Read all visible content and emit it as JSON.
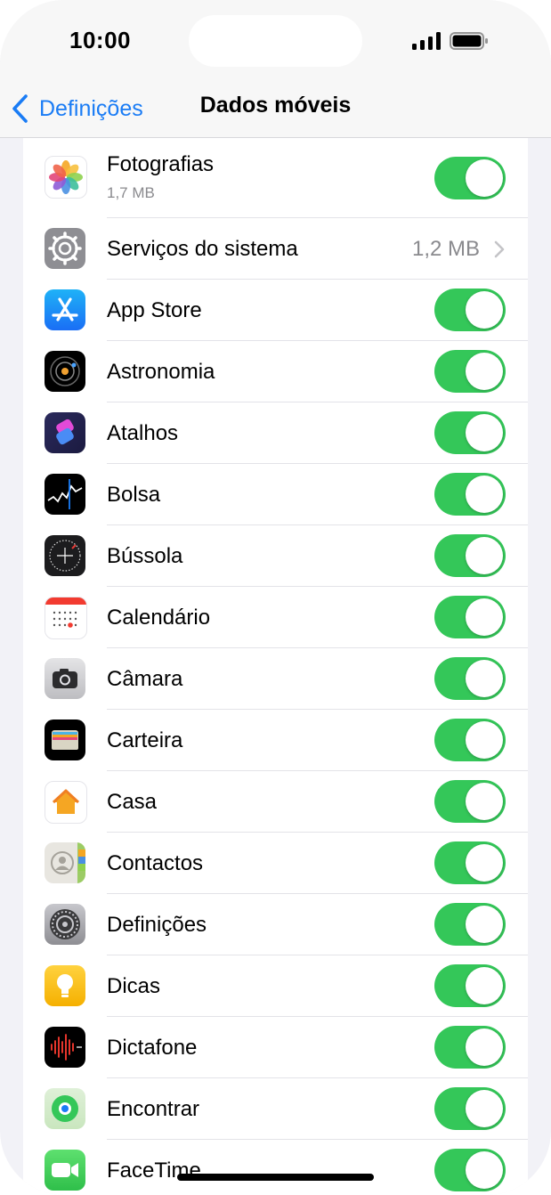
{
  "status_bar": {
    "time": "10:00",
    "icons": [
      "cellular-signal-icon",
      "battery-icon"
    ]
  },
  "nav": {
    "back_label": "Definições",
    "title": "Dados móveis"
  },
  "rows": [
    {
      "name": "fotografias",
      "label": "Fotografias",
      "sub": "1,7 MB",
      "icon": "photos-icon",
      "toggle": true
    },
    {
      "name": "servicos-do-sistema",
      "label": "Serviços do sistema",
      "value": "1,2 MB",
      "icon": "gear-icon",
      "disclosure": true
    },
    {
      "name": "app-store",
      "label": "App Store",
      "icon": "app-store-icon",
      "toggle": true
    },
    {
      "name": "astronomia",
      "label": "Astronomia",
      "icon": "astronomy-icon",
      "toggle": true
    },
    {
      "name": "atalhos",
      "label": "Atalhos",
      "icon": "shortcuts-icon",
      "toggle": true
    },
    {
      "name": "bolsa",
      "label": "Bolsa",
      "icon": "stocks-icon",
      "toggle": true
    },
    {
      "name": "bussola",
      "label": "Bússola",
      "icon": "compass-icon",
      "toggle": true
    },
    {
      "name": "calendario",
      "label": "Calendário",
      "icon": "calendar-icon",
      "toggle": true
    },
    {
      "name": "camara",
      "label": "Câmara",
      "icon": "camera-icon",
      "toggle": true
    },
    {
      "name": "carteira",
      "label": "Carteira",
      "icon": "wallet-icon",
      "toggle": true
    },
    {
      "name": "casa",
      "label": "Casa",
      "icon": "home-icon",
      "toggle": true
    },
    {
      "name": "contactos",
      "label": "Contactos",
      "icon": "contacts-icon",
      "toggle": true
    },
    {
      "name": "definicoes",
      "label": "Definições",
      "icon": "settings-icon",
      "toggle": true
    },
    {
      "name": "dicas",
      "label": "Dicas",
      "icon": "tips-icon",
      "toggle": true
    },
    {
      "name": "dictafone",
      "label": "Dictafone",
      "icon": "voice-memos-icon",
      "toggle": true
    },
    {
      "name": "encontrar",
      "label": "Encontrar",
      "icon": "find-my-icon",
      "toggle": true
    },
    {
      "name": "facetime",
      "label": "FaceTime",
      "icon": "facetime-icon",
      "toggle": true
    }
  ],
  "colors": {
    "accent": "#1a7cf5",
    "toggle_on": "#34c759",
    "secondary_text": "#8a8a8e"
  }
}
